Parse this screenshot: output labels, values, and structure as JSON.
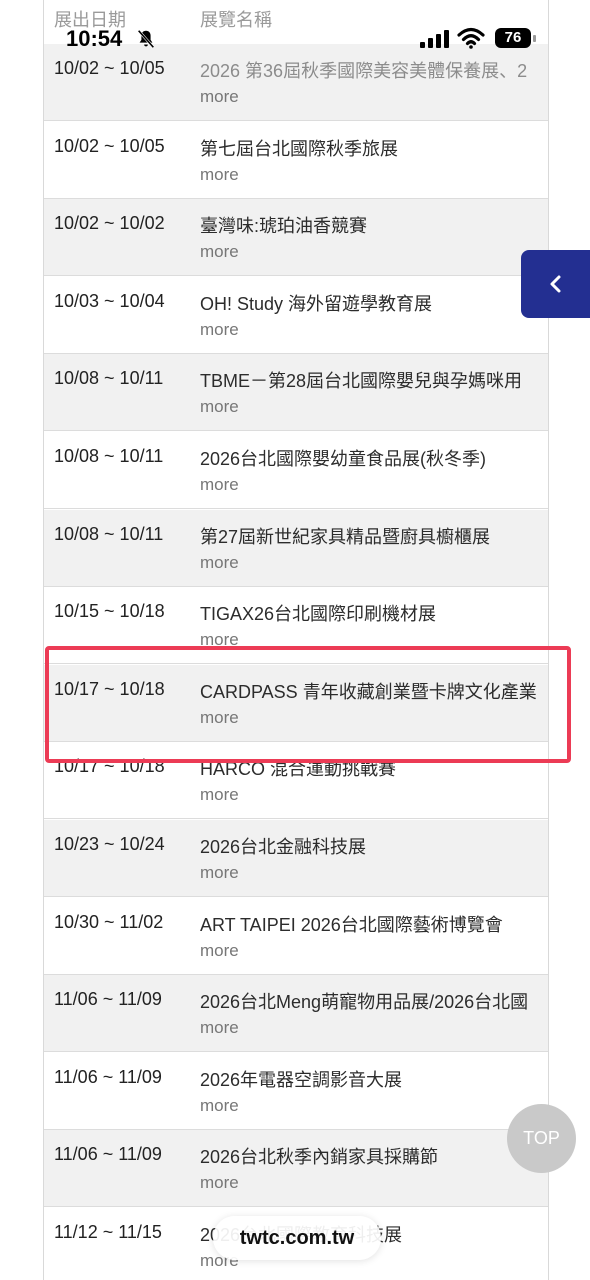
{
  "header": {
    "date_col": "展出日期",
    "name_col": "展覽名稱"
  },
  "status_bar": {
    "time": "10:54",
    "battery": "76"
  },
  "rows": [
    {
      "date": "10/02 ~ 10/05",
      "name": "2026 第36屆秋季國際美容美體保養展、2",
      "more": "more"
    },
    {
      "date": "10/02 ~ 10/05",
      "name": "第七屆台北國際秋季旅展",
      "more": "more"
    },
    {
      "date": "10/02 ~ 10/02",
      "name": "臺灣味:琥珀油香競賽",
      "more": "more"
    },
    {
      "date": "10/03 ~ 10/04",
      "name": "OH! Study 海外留遊學教育展",
      "more": "more"
    },
    {
      "date": "10/08 ~ 10/11",
      "name": "TBME－第28屆台北國際嬰兒與孕媽咪用",
      "more": "more"
    },
    {
      "date": "10/08 ~ 10/11",
      "name": "2026台北國際嬰幼童食品展(秋冬季)",
      "more": "more"
    },
    {
      "date": "10/08 ~ 10/11",
      "name": "第27屆新世紀家具精品暨廚具櫥櫃展",
      "more": "more"
    },
    {
      "date": "10/15 ~ 10/18",
      "name": "TIGAX26台北國際印刷機材展",
      "more": "more"
    },
    {
      "date": "10/17 ~ 10/18",
      "name": "CARDPASS 青年收藏創業暨卡牌文化產業",
      "more": "more"
    },
    {
      "date": "10/17 ~ 10/18",
      "name": "HARCO 混合運動挑戰賽",
      "more": "more"
    },
    {
      "date": "10/23 ~ 10/24",
      "name": "2026台北金融科技展",
      "more": "more"
    },
    {
      "date": "10/30 ~ 11/02",
      "name": "ART TAIPEI 2026台北國際藝術博覽會",
      "more": "more"
    },
    {
      "date": "11/06 ~ 11/09",
      "name": "2026台北Meng萌寵物用品展/2026台北國",
      "more": "more"
    },
    {
      "date": "11/06 ~ 11/09",
      "name": "2026年電器空調影音大展",
      "more": "more"
    },
    {
      "date": "11/06 ~ 11/09",
      "name": "2026台北秋季內銷家具採購節",
      "more": "more"
    },
    {
      "date": "11/12 ~ 11/15",
      "name": "2026台北國際教育科技展",
      "more": "more"
    }
  ],
  "top_button": "TOP",
  "url_bar": "twtc.com.tw",
  "colors": {
    "accent": "#232f91",
    "highlight": "#ec3b55",
    "shaded_row": "#f1f1f1"
  }
}
